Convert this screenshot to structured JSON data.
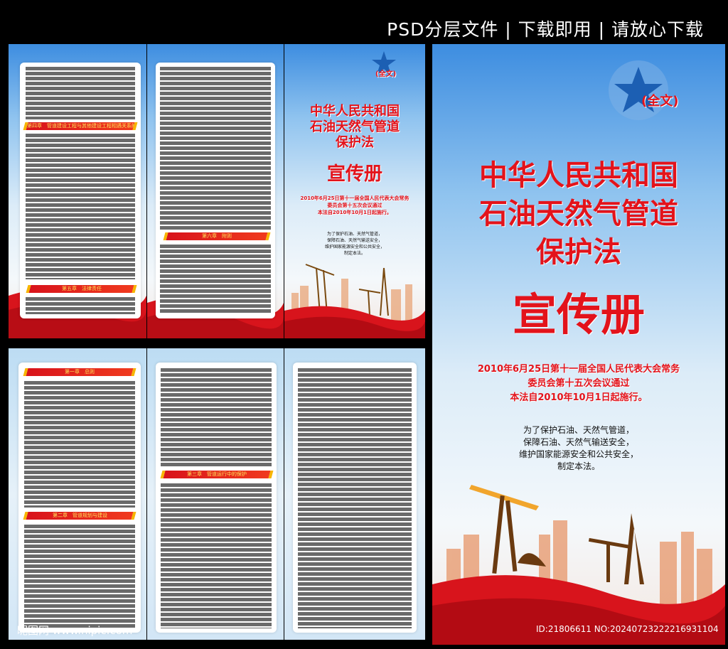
{
  "topbar": {
    "text": "PSD分层文件 | 下载即用 | 请放心下载"
  },
  "cover": {
    "full_text": "(全文)",
    "title_line1": "中华人民共和国",
    "title_line2": "石油天然气管道",
    "title_line3": "保护法",
    "subtitle": "宣传册",
    "passed_line1": "2010年6月25日第十一届全国人民代表大会常务",
    "passed_line2": "委员会第十五次会议通过",
    "passed_line3": "本法自2010年10月1日起施行。",
    "purpose_line1": "为了保护石油、天然气管道，",
    "purpose_line2": "保障石油、天然气输送安全，",
    "purpose_line3": "维护国家能源安全和公共安全，",
    "purpose_line4": "制定本法。"
  },
  "small_cover": {
    "full_text": "(全文)",
    "title_line1": "中华人民共和国",
    "title_line2": "石油天然气管道",
    "title_line3": "保护法",
    "subtitle": "宣传册",
    "passed_line1": "2010年6月25日第十一届全国人民代表大会常务",
    "passed_line2": "委员会第十五次会议通过",
    "passed_line3": "本法自2010年10月1日起施行。",
    "purpose_line1": "为了保护石油、天然气管道，",
    "purpose_line2": "保障石油、天然气输送安全，",
    "purpose_line3": "维护国家能源安全和公共安全，",
    "purpose_line4": "制定本法。"
  },
  "chapters": {
    "ch1": "第一章　总则",
    "ch2": "第二章　管道规划与建设",
    "ch3": "第三章　管道运行中的保护",
    "ch4": "第四章　管道建设工程与其他建设工程相遇关系的处理",
    "ch5": "第五章　法律责任",
    "ch6": "第六章　附则"
  },
  "watermark": {
    "left": "昵图网 www.nipic.com",
    "right": "ID:21806611 NO:20240723222216931104"
  },
  "colors": {
    "red": "#e3131b",
    "gold": "#f7b500",
    "sky": "#3d8de0"
  }
}
